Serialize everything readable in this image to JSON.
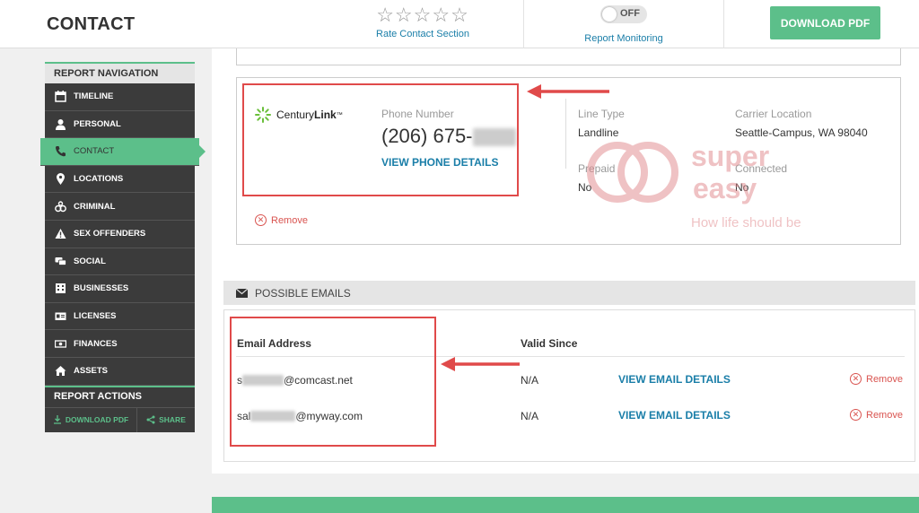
{
  "header": {
    "title": "CONTACT",
    "rating_stars": "☆☆☆☆☆",
    "rate_label": "Rate Contact Section",
    "monitoring_toggle": "OFF",
    "monitoring_label": "Report Monitoring",
    "download_pdf": "DOWNLOAD PDF"
  },
  "sidebar": {
    "nav_title": "REPORT NAVIGATION",
    "items": [
      {
        "label": "TIMELINE",
        "icon": "calendar-icon"
      },
      {
        "label": "PERSONAL",
        "icon": "person-icon"
      },
      {
        "label": "CONTACT",
        "icon": "phone-icon",
        "active": true
      },
      {
        "label": "LOCATIONS",
        "icon": "map-pin-icon"
      },
      {
        "label": "CRIMINAL",
        "icon": "handcuffs-icon"
      },
      {
        "label": "SEX OFFENDERS",
        "icon": "warning-icon"
      },
      {
        "label": "SOCIAL",
        "icon": "chat-icon"
      },
      {
        "label": "BUSINESSES",
        "icon": "building-icon"
      },
      {
        "label": "LICENSES",
        "icon": "id-card-icon"
      },
      {
        "label": "FINANCES",
        "icon": "money-icon"
      },
      {
        "label": "ASSETS",
        "icon": "home-icon"
      }
    ],
    "actions_title": "REPORT ACTIONS",
    "action_download": "DOWNLOAD PDF",
    "action_share": "SHARE"
  },
  "phone": {
    "carrier_prefix": "Century",
    "carrier_bold": "Link",
    "carrier_tm": "™",
    "number_label": "Phone Number",
    "number": "(206) 675-",
    "view_details": "VIEW PHONE DETAILS",
    "line_type_label": "Line Type",
    "line_type": "Landline",
    "carrier_location_label": "Carrier Location",
    "carrier_location": "Seattle-Campus, WA 98040",
    "prepaid_label": "Prepaid",
    "prepaid": "No",
    "connected_label": "Connected",
    "connected": "No",
    "remove": "Remove"
  },
  "emails": {
    "section_title": "POSSIBLE EMAILS",
    "col_email": "Email Address",
    "col_valid": "Valid Since",
    "rows": [
      {
        "prefix": "s",
        "domain": "@comcast.net",
        "valid_since": "N/A",
        "view": "VIEW EMAIL DETAILS",
        "remove": "Remove"
      },
      {
        "prefix": "sal",
        "domain": "@myway.com",
        "valid_since": "N/A",
        "view": "VIEW EMAIL DETAILS",
        "remove": "Remove"
      }
    ]
  },
  "watermark": {
    "line1": "super",
    "line2": "easy",
    "tagline": "How life should be"
  },
  "colors": {
    "accent_green": "#5cbf8a",
    "link_blue": "#1a7ea8",
    "annotation_red": "#e04a4a",
    "sidebar_dark": "#3b3b3b"
  }
}
